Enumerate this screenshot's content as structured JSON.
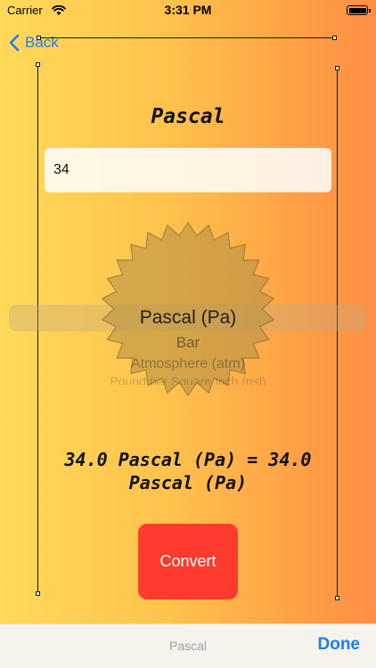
{
  "status_bar": {
    "carrier": "Carrier",
    "time": "3:31 PM"
  },
  "nav": {
    "back_label": "Back"
  },
  "converter": {
    "title": "Pascal",
    "input_value": "34",
    "picker_options": [
      "Pascal (Pa)",
      "Bar",
      "Atmosphere (atm)",
      "Pound per Square Inch (psi)"
    ],
    "selected_option": "Pascal (Pa)",
    "result": "34.0 Pascal (Pa) = 34.0 Pascal (Pa)",
    "convert_label": "Convert"
  },
  "toolbar": {
    "center_label": "Pascal",
    "done_label": "Done"
  },
  "icons": {
    "back": "chevron-left-icon",
    "wifi": "wifi-icon",
    "battery": "battery-icon",
    "seal": "seal-badge-icon"
  },
  "colors": {
    "accent": "#1E7CF0",
    "convert_button": "#FF3B30",
    "gradient_start": "#FFD95A",
    "gradient_end": "#FF8F44"
  }
}
